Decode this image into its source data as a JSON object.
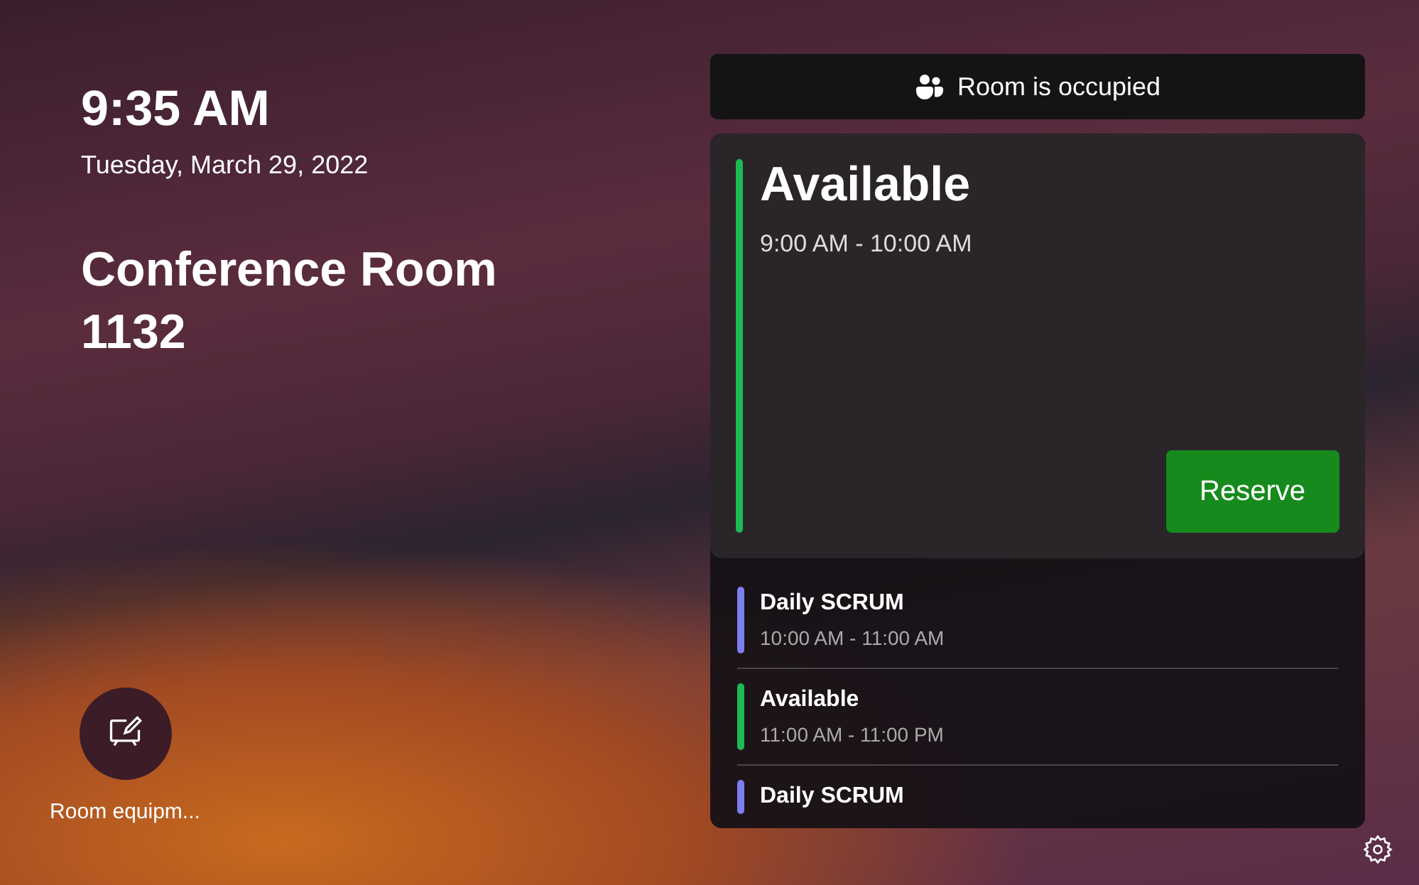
{
  "clock": {
    "time": "9:35 AM",
    "date": "Tuesday, March 29, 2022"
  },
  "room": {
    "name": "Conference Room 1132"
  },
  "status_banner": {
    "text": "Room is occupied"
  },
  "current": {
    "title": "Available",
    "time": "9:00 AM - 10:00 AM",
    "color": "#1db954",
    "button": "Reserve"
  },
  "agenda": [
    {
      "title": "Daily SCRUM",
      "time": "10:00 AM - 11:00 AM",
      "color": "#7b7ff0"
    },
    {
      "title": "Available",
      "time": "11:00 AM - 11:00 PM",
      "color": "#1db954"
    },
    {
      "title": "Daily SCRUM",
      "color": "#7b7ff0"
    }
  ],
  "equipment": {
    "label": "Room equipm..."
  }
}
